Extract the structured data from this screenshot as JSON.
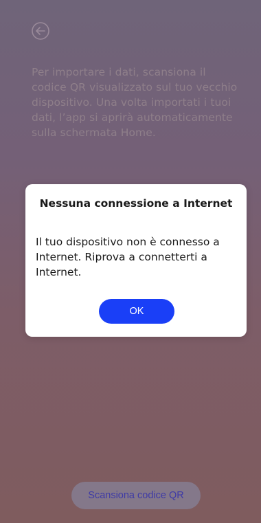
{
  "header": {
    "back_icon": "arrow-left-circle-icon"
  },
  "main": {
    "instructions": "Per importare i dati, scansiona il codice QR visualizzato sul tuo vecchio dispositivo. Una volta importati i tuoi dati, l’app si aprirà automaticamente sulla schermata Home.",
    "scan_button_label": "Scansiona codice QR"
  },
  "dialog": {
    "title": "Nessuna connessione a Internet",
    "message": "Il tuo dispositivo non è connesso a Internet. Riprova a connetterti a Internet.",
    "ok_label": "OK"
  },
  "colors": {
    "primary_button": "#1a3ff7",
    "dialog_background": "#ffffff"
  }
}
